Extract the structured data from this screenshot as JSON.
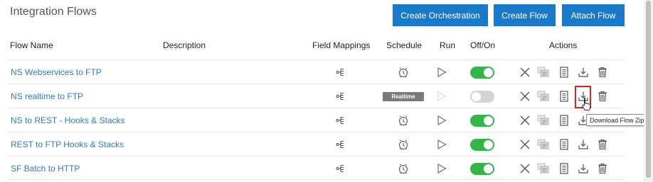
{
  "page": {
    "title": "Integration Flows"
  },
  "toolbar": {
    "create_orchestration": "Create Orchestration",
    "create_flow": "Create Flow",
    "attach_flow": "Attach Flow"
  },
  "columns": {
    "flow_name": "Flow Name",
    "description": "Description",
    "field_mappings": "Field Mappings",
    "schedule": "Schedule",
    "run": "Run",
    "off_on": "Off/On",
    "actions": "Actions"
  },
  "rows": [
    {
      "name": "NS Webservices to FTP",
      "description": "",
      "schedule": "clock",
      "enabled": true
    },
    {
      "name": "NS realtime to FTP",
      "description": "",
      "schedule": "Realtime",
      "enabled": false
    },
    {
      "name": "NS to REST - Hooks & Stacks",
      "description": "",
      "schedule": "clock",
      "enabled": true
    },
    {
      "name": "REST to FTP Hooks & Stacks",
      "description": "",
      "schedule": "clock",
      "enabled": true
    },
    {
      "name": "SF Batch to HTTP",
      "description": "",
      "schedule": "clock",
      "enabled": true
    }
  ],
  "tooltip": {
    "text": "Download Flow Zip"
  },
  "colors": {
    "accent": "#1a7ac7",
    "link": "#2f7bbf",
    "toggle_on": "#35b44a",
    "toggle_off": "#d4d4d4",
    "highlight": "#d9231c"
  },
  "icons": [
    "field-mapping-icon",
    "schedule-clock-icon",
    "run-play-icon",
    "delete-x-icon",
    "clone-icon",
    "audit-log-icon",
    "download-icon",
    "trash-icon",
    "hand-cursor-icon"
  ]
}
